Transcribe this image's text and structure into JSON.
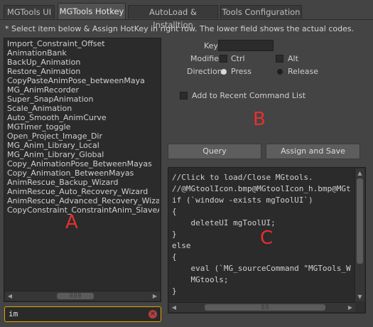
{
  "tabs": [
    {
      "label": "MGTools UI",
      "active": false
    },
    {
      "label": "MGTools Hotkey",
      "active": true
    },
    {
      "label": "AutoLoad & Installtion",
      "active": false
    },
    {
      "label": "Tools Configuration",
      "active": false
    }
  ],
  "instructions": "* Select item below & Assign HotKey in right row. The lower field shows the actual codes.",
  "command_list": [
    "Import_Constraint_Offset",
    "AnimationBank",
    "BackUp_Animation",
    "Restore_Animation",
    "CopyPasteAnimPose_betweenMaya",
    "MG_AnimRecorder",
    "Super_SnapAnimation",
    "Scale_Animation",
    "Auto_Smooth_AnimCurve",
    "MGTimer_toggle",
    "Open_Project_Image_Dir",
    "MG_Anim_Library_Local",
    "MG_Anim_Library_Global",
    "Copy_AnimationPose_BetweenMayas",
    "Copy_Animation_BetweenMayas",
    "AnimRescue_Backup_Wizard",
    "AnimRescue_Auto_Recovery_Wizard",
    "AnimRescue_Advanced_Recovery_Wizard",
    "CopyConstraint_ConstraintAnim_SlaveAnim_"
  ],
  "search": {
    "value": "im"
  },
  "hotkey": {
    "key_label": "Key",
    "key_value": "",
    "modifier_label": "Modifier",
    "ctrl_label": "Ctrl",
    "alt_label": "Alt",
    "direction_label": "Direction",
    "press_label": "Press",
    "release_label": "Release",
    "direction_selected": "Press",
    "add_recent_label": "Add to Recent Command List"
  },
  "buttons": {
    "query": "Query",
    "assign_save": "Assign and Save"
  },
  "code_lines": [
    "//Click to load/Close MGtools.",
    "//@MGtoolIcon.bmp@MGtoolIcon_h.bmp@MGt",
    "if (`window -exists mgToolUI`)",
    "{",
    "    deleteUI mgToolUI;",
    "}",
    "else",
    "{",
    "    eval (`MG_sourceCommand \"MGTools_W",
    "    MGtools;",
    "}"
  ],
  "annotations": {
    "a": "A",
    "b": "B",
    "c": "C"
  },
  "colors": {
    "annotation": "#e53030",
    "focus_border": "#e0a400"
  }
}
